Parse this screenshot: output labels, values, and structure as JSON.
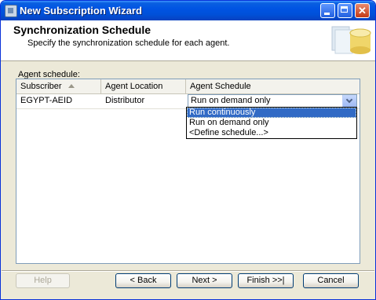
{
  "window": {
    "title": "New Subscription Wizard"
  },
  "header": {
    "title": "Synchronization Schedule",
    "subtitle": "Specify the synchronization schedule for each agent."
  },
  "section_label": "Agent schedule:",
  "grid": {
    "columns": [
      "Subscriber",
      "Agent Location",
      "Agent Schedule"
    ],
    "sort_column": "Subscriber",
    "sort_direction": "ascending",
    "rows": [
      {
        "subscriber": "EGYPT-AEID",
        "agent_location": "Distributor",
        "agent_schedule": "Run on demand only"
      }
    ]
  },
  "schedule_dropdown": {
    "selected": "Run on demand only",
    "highlighted": "Run continuously",
    "options": [
      "Run continuously",
      "Run on demand only",
      "<Define schedule...>"
    ]
  },
  "buttons": {
    "help": "Help",
    "back": "< Back",
    "next": "Next >",
    "finish": "Finish >>|",
    "cancel": "Cancel"
  },
  "colors": {
    "titlebar": "#0054e3",
    "selection": "#316ac5",
    "dialog_bg": "#ece9d8"
  }
}
